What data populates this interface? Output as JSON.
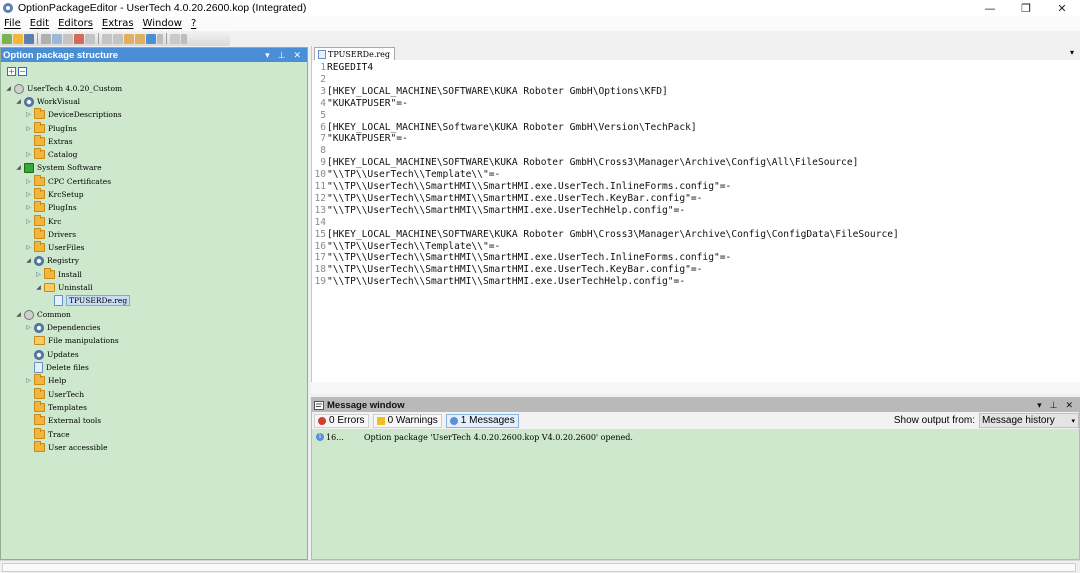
{
  "window": {
    "title": "OptionPackageEditor - UserTech 4.0.20.2600.kop (Integrated)",
    "minimize": "—",
    "maximize": "❐",
    "close": "✕"
  },
  "menu": [
    "File",
    "Edit",
    "Editors",
    "Extras",
    "Window",
    "?"
  ],
  "left_panel": {
    "title": "Option package structure",
    "header_buttons": [
      "▾",
      "⊥",
      "✕"
    ],
    "expand_all": "+",
    "collapse_all": "−",
    "tree": [
      {
        "label": "UserTech 4.0.20_Custom",
        "icon": "package-icon",
        "indent": 0,
        "tri": "◢"
      },
      {
        "label": "WorkVisual",
        "icon": "gear-icon",
        "indent": 1,
        "tri": "◢"
      },
      {
        "label": "DeviceDescriptions",
        "icon": "folder-icon",
        "indent": 2,
        "tri": "▷"
      },
      {
        "label": "PlugIns",
        "icon": "folder-icon",
        "indent": 2,
        "tri": "▷"
      },
      {
        "label": "Extras",
        "icon": "folder-icon",
        "indent": 2,
        "tri": ""
      },
      {
        "label": "Catalog",
        "icon": "catalog-icon",
        "indent": 2,
        "tri": "▷"
      },
      {
        "label": "System Software",
        "icon": "system-software-icon",
        "indent": 1,
        "tri": "◢"
      },
      {
        "label": "CPC Certificates",
        "icon": "folder-icon",
        "indent": 2,
        "tri": "▷"
      },
      {
        "label": "KrcSetup",
        "icon": "folder-icon",
        "indent": 2,
        "tri": "▷"
      },
      {
        "label": "PlugIns",
        "icon": "folder-icon",
        "indent": 2,
        "tri": "▷"
      },
      {
        "label": "Krc",
        "icon": "folder-icon",
        "indent": 2,
        "tri": "▷"
      },
      {
        "label": "Drivers",
        "icon": "folder-icon",
        "indent": 2,
        "tri": ""
      },
      {
        "label": "UserFiles",
        "icon": "folder-icon",
        "indent": 2,
        "tri": "▷"
      },
      {
        "label": "Registry",
        "icon": "registry-icon",
        "indent": 2,
        "tri": "◢"
      },
      {
        "label": "Install",
        "icon": "folder-icon",
        "indent": 3,
        "tri": "▷"
      },
      {
        "label": "Uninstall",
        "icon": "folder-open-icon",
        "indent": 3,
        "tri": "◢"
      },
      {
        "label": "TPUSERDe.reg",
        "icon": "reg-file-icon",
        "indent": 4,
        "tri": "",
        "selected": true
      },
      {
        "label": "Common",
        "icon": "common-icon",
        "indent": 1,
        "tri": "◢"
      },
      {
        "label": "Dependencies",
        "icon": "dependencies-icon",
        "indent": 2,
        "tri": "▷"
      },
      {
        "label": "File manipulations",
        "icon": "file-manipulation-icon",
        "indent": 2,
        "tri": ""
      },
      {
        "label": "Updates",
        "icon": "updates-icon",
        "indent": 2,
        "tri": ""
      },
      {
        "label": "Delete files",
        "icon": "delete-files-icon",
        "indent": 2,
        "tri": ""
      },
      {
        "label": "Help",
        "icon": "folder-icon",
        "indent": 2,
        "tri": "▷"
      },
      {
        "label": "UserTech",
        "icon": "folder-icon",
        "indent": 2,
        "tri": ""
      },
      {
        "label": "Templates",
        "icon": "folder-icon",
        "indent": 2,
        "tri": ""
      },
      {
        "label": "External tools",
        "icon": "external-tools-icon",
        "indent": 2,
        "tri": ""
      },
      {
        "label": "Trace",
        "icon": "folder-icon",
        "indent": 2,
        "tri": ""
      },
      {
        "label": "User accessible",
        "icon": "folder-icon",
        "indent": 2,
        "tri": ""
      }
    ]
  },
  "editor": {
    "tab_label": "TPUSERDe.reg",
    "close_glyph": "▾",
    "lines": [
      {
        "n": "1",
        "text": "REGEDIT4"
      },
      {
        "n": "2",
        "text": ""
      },
      {
        "n": "3",
        "text": "[HKEY_LOCAL_MACHINE\\SOFTWARE\\KUKA Roboter GmbH\\Options\\KFD]"
      },
      {
        "n": "4",
        "text": "\"KUKATPUSER\"=-"
      },
      {
        "n": "5",
        "text": ""
      },
      {
        "n": "6",
        "text": "[HKEY_LOCAL_MACHINE\\Software\\KUKA Roboter GmbH\\Version\\TechPack]"
      },
      {
        "n": "7",
        "text": "\"KUKATPUSER\"=-"
      },
      {
        "n": "8",
        "text": ""
      },
      {
        "n": "9",
        "text": "[HKEY_LOCAL_MACHINE\\SOFTWARE\\KUKA Roboter GmbH\\Cross3\\Manager\\Archive\\Config\\All\\FileSource]"
      },
      {
        "n": "10",
        "text": "\"\\\\TP\\\\UserTech\\\\Template\\\\\"=-"
      },
      {
        "n": "11",
        "text": "\"\\\\TP\\\\UserTech\\\\SmartHMI\\\\SmartHMI.exe.UserTech.InlineForms.config\"=-"
      },
      {
        "n": "12",
        "text": "\"\\\\TP\\\\UserTech\\\\SmartHMI\\\\SmartHMI.exe.UserTech.KeyBar.config\"=-"
      },
      {
        "n": "13",
        "text": "\"\\\\TP\\\\UserTech\\\\SmartHMI\\\\SmartHMI.exe.UserTechHelp.config\"=-"
      },
      {
        "n": "14",
        "text": ""
      },
      {
        "n": "15",
        "text": "[HKEY_LOCAL_MACHINE\\SOFTWARE\\KUKA Roboter GmbH\\Cross3\\Manager\\Archive\\Config\\ConfigData\\FileSource]"
      },
      {
        "n": "16",
        "text": "\"\\\\TP\\\\UserTech\\\\Template\\\\\"=-"
      },
      {
        "n": "17",
        "text": "\"\\\\TP\\\\UserTech\\\\SmartHMI\\\\SmartHMI.exe.UserTech.InlineForms.config\"=-"
      },
      {
        "n": "18",
        "text": "\"\\\\TP\\\\UserTech\\\\SmartHMI\\\\SmartHMI.exe.UserTech.KeyBar.config\"=-"
      },
      {
        "n": "19",
        "text": "\"\\\\TP\\\\UserTech\\\\SmartHMI\\\\SmartHMI.exe.UserTechHelp.config\"=-"
      }
    ]
  },
  "message_window": {
    "title": "Message window",
    "header_buttons": [
      "▾",
      "⊥",
      "✕"
    ],
    "errors": "0 Errors",
    "warnings": "0 Warnings",
    "messages": "1 Messages",
    "show_output_label": "Show output from:",
    "show_output_value": "Message history",
    "rows": [
      {
        "time": "16...",
        "text": "Option package 'UserTech 4.0.20.2600.kop V4.0.20.2600' opened."
      }
    ]
  },
  "colors": {
    "panel_header": "#4a8fd6",
    "tree_bg": "#cde8cd",
    "folder": "#f2b63c"
  }
}
